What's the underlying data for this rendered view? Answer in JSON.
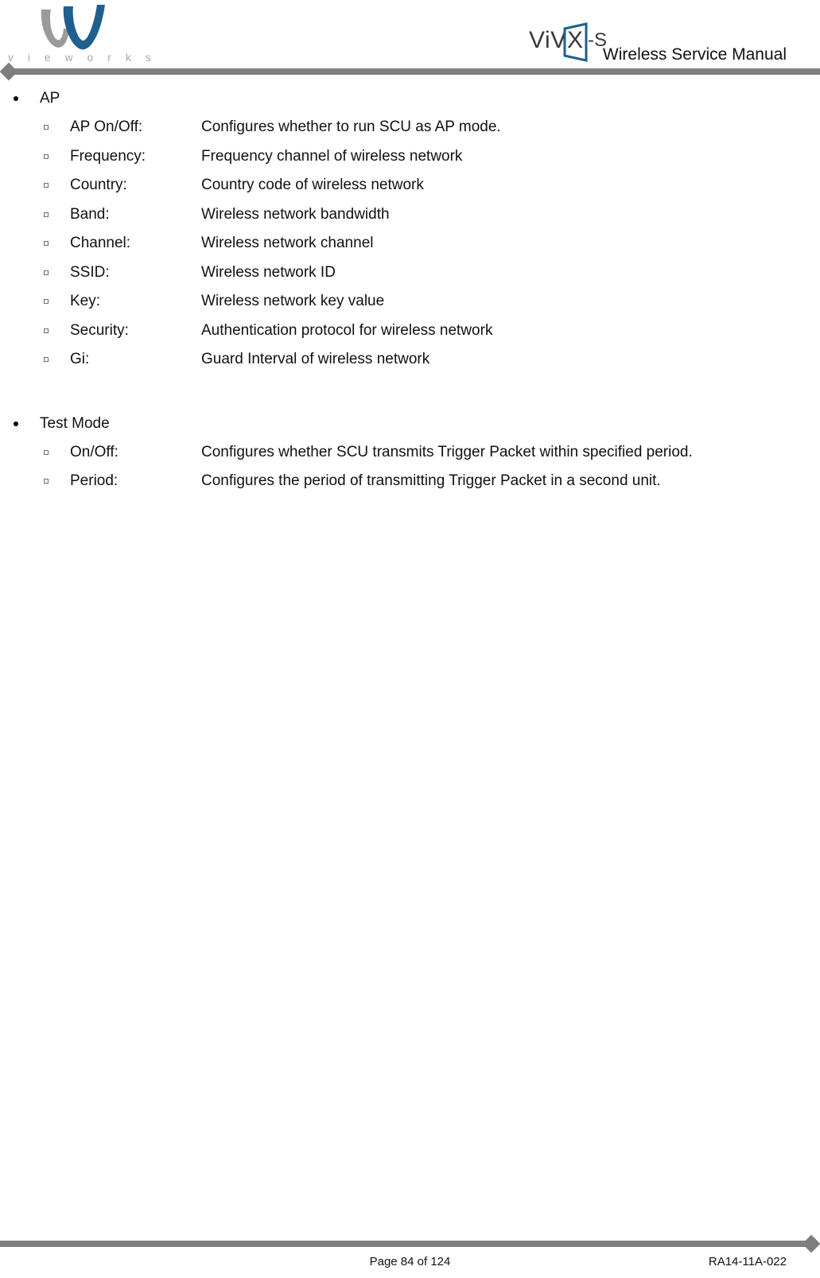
{
  "header": {
    "brand_wordmark": "v i e w o r k s",
    "brand_mark_icon": "vieworks-w-logo",
    "product_logo": {
      "text_before": "ViV",
      "text_inside": "X",
      "text_after": "-S",
      "full": "ViVIX-S",
      "accent_color": "#1f5f8f"
    },
    "manual_title": "Wireless Service Manual",
    "rule_color": "#7e7e7e"
  },
  "content": {
    "groups": [
      {
        "title": "AP",
        "items": [
          {
            "label": "AP On/Off:",
            "desc": "Configures whether to run SCU as AP mode."
          },
          {
            "label": "Frequency:",
            "desc": "Frequency channel of wireless network"
          },
          {
            "label": "Country:",
            "desc": "Country code of wireless network"
          },
          {
            "label": "Band:",
            "desc": "Wireless network bandwidth"
          },
          {
            "label": "Channel:",
            "desc": "Wireless network channel"
          },
          {
            "label": "SSID:",
            "desc": "Wireless network ID"
          },
          {
            "label": "Key:",
            "desc": "Wireless network key value"
          },
          {
            "label": "Security:",
            "desc": "Authentication protocol for wireless network"
          },
          {
            "label": "Gi:",
            "desc": "Guard Interval of wireless network"
          }
        ]
      },
      {
        "title": "Test Mode",
        "items": [
          {
            "label": "On/Off:",
            "desc": "Configures whether SCU transmits Trigger Packet within specified period."
          },
          {
            "label": "Period:",
            "desc": "Configures the period of transmitting Trigger Packet in a second unit."
          }
        ]
      }
    ]
  },
  "footer": {
    "page_label": "Page 84 of 124",
    "document_code": "RA14-11A-022",
    "rule_color": "#7e7e7e"
  }
}
